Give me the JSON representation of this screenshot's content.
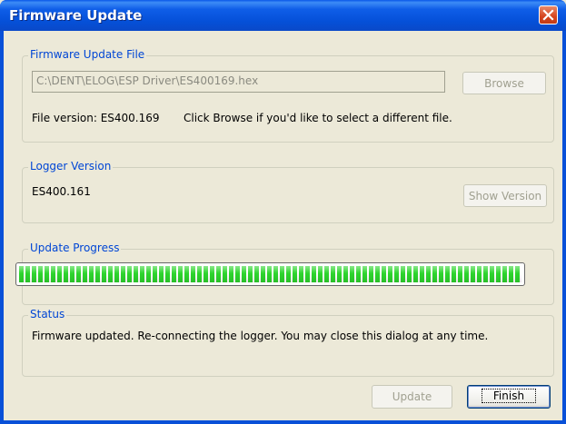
{
  "window": {
    "title": "Firmware Update"
  },
  "firmware_file": {
    "legend": "Firmware Update File",
    "path_value": "C:\\DENT\\ELOG\\ESP Driver\\ES400169.hex",
    "browse_label": "Browse",
    "version_text": "File version: ES400.169",
    "hint_text": "Click Browse if you'd like to select a different file."
  },
  "logger": {
    "legend": "Logger Version",
    "version": "ES400.161",
    "show_version_label": "Show Version"
  },
  "progress": {
    "legend": "Update Progress",
    "fraction": 1.0
  },
  "status": {
    "legend": "Status",
    "text": "Firmware updated. Re-connecting the logger. You may close this dialog at any time."
  },
  "buttons": {
    "update_label": "Update",
    "finish_label": "Finish"
  },
  "colors": {
    "titlebar": "#0a58e8",
    "legend": "#0046d5",
    "progress_fill": "#2dd52d",
    "close": "#d5451f"
  }
}
